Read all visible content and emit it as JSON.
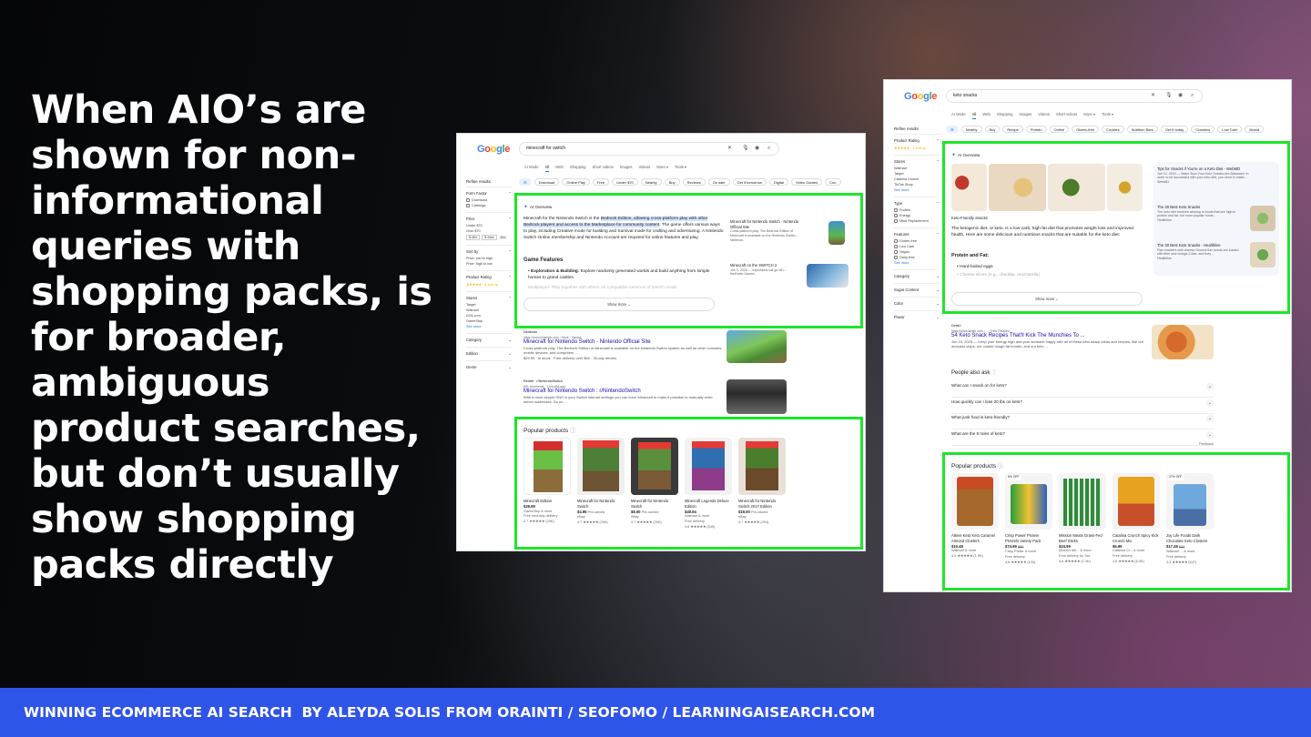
{
  "headline": "When AIO’s are shown for non-informational queries with shopping packs, is for broader, ambiguous product searches, but don’t usually show shopping packs directly",
  "footer": "WINNING ECOMMERCE AI SEARCH  BY ALEYDA SOLIS FROM ORAINTI / SEOFOMO / LEARNINGAISEARCH.COM",
  "colors": {
    "footer_bg": "#2f54e8",
    "highlight_box": "#1ee52b",
    "text": "#ffffff"
  },
  "left_screenshot": {
    "logo": [
      "G",
      "o",
      "o",
      "g",
      "l",
      "e"
    ],
    "query": "minecraft for switch",
    "tabs": [
      "AI Mode",
      "All",
      "Web",
      "Shopping",
      "Short videos",
      "Images",
      "Videos",
      "More ▾",
      "Tools ▾"
    ],
    "chips": [
      "Download",
      "Online Play",
      "Free",
      "Under $70",
      "Nearby",
      "Buy",
      "Reviews",
      "On sale",
      "Get it tomorrow",
      "Digital",
      "Video Games",
      "Con"
    ],
    "sidebar": {
      "title": "Refine results",
      "form_factor": "Form Factor",
      "ff_opts": [
        "Download",
        "Cartridge"
      ],
      "price": "Price",
      "price_opts": [
        "Under $70",
        "Over $70"
      ],
      "price_min": "$ Min",
      "price_max": "$ Max",
      "price_go": "Go",
      "sort": "Sort by",
      "sort_opts": [
        "Price: low to high",
        "Price: high to low"
      ],
      "rating": "Product Rating",
      "rating_val": "★★★★★ · 4 and up",
      "stores": "Stores",
      "stores_opts": [
        "Target",
        "Walmart",
        "G2A.com",
        "GameStop"
      ],
      "see_more": "See more",
      "category": "Category",
      "edition": "Edition",
      "genre": "Genre"
    },
    "aio": {
      "label": "AI Overview",
      "p1_a": "Minecraft for the Nintendo Switch is the ",
      "p1_hl": "Bedrock Edition, allowing cross-platform play with other Bedrock players and access to the Marketplace for community content",
      "p1_b": ". The game offers various ways to play, including Creative mode for building and Survival mode for crafting and adventuring. A Nintendo Switch Online membership and Nintendo Account are required for online features and play.",
      "features_title": "Game Features",
      "feature1_b": "Exploration & Building:",
      "feature1": " Explore randomly generated worlds and build anything from simple homes to grand castles.",
      "feature2": "Multiplayer: Play together with others on compatible versions of Switch mode.",
      "show_more": "Show more ⌄",
      "side1_title": "Minecraft for Nintendo Switch - Nintendo Official Site",
      "side1_desc": "Cross-platform play. The Bedrock Edition of Minecraft is available on the Nintendo Switch...",
      "side1_src": "Nintendo",
      "side2_title": "Minecraft on the SWITCH 2",
      "side2_desc": "Jun 5, 2025 — explosions will go off i...",
      "side2_src": "theRobin Games"
    },
    "results": [
      {
        "src": "Nintendo",
        "url": "https://www.nintendo.com › Store › Games",
        "title": "Minecraft for Nintendo Switch - Nintendo Official Site",
        "desc": "Cross-platform play. The Bedrock Edition of Minecraft is available on the Nintendo Switch system as well as other consoles, mobile devices, and computers ...",
        "extra": "$29.99 · In stock · Free delivery over $50 · 30-day returns"
      },
      {
        "src": "Reddit · r/NintendoSwitch",
        "url": "50+ comments · 3 months ago",
        "title": "Minecraft for Nintendo Switch : r/NintendoSwitch",
        "desc": "With a more simple DNS in your Switch internet settings you can force Minecraft to make it possible to manually enter server addresses. So no ..."
      }
    ],
    "popular_title": "Popular products",
    "products": [
      {
        "name": "Minecraft Edition",
        "price": "$29.99",
        "store": "GameStop & more",
        "ship": "Free next-day delivery",
        "rating": "4.7 ★★★★★ (29K)"
      },
      {
        "name": "Minecraft for Nintendo Switch",
        "price": "$4.95",
        "pre": "Pre-owned",
        "store": "eBay",
        "rating": "4.7 ★★★★★ (29K)"
      },
      {
        "name": "Minecraft for Nintendo Switch",
        "price": "$8.00",
        "pre": "Pre-owned",
        "store": "eBay",
        "rating": "4.7 ★★★★★ (29K)"
      },
      {
        "name": "Minecraft Legends Deluxe Edition",
        "price": "$49.94",
        "store": "Walmart & more",
        "ship": "Free delivery",
        "rating": "4.6 ★★★★★ (549)"
      },
      {
        "name": "Minecraft for Nintendo Switch 2017 Edition",
        "price": "$19.00",
        "pre": "Pre-owned",
        "store": "eBay",
        "rating": "4.7 ★★★★★ (294)"
      }
    ]
  },
  "right_screenshot": {
    "query": "keto snacks",
    "tabs": [
      "AI Mode",
      "All",
      "Web",
      "Shopping",
      "Images",
      "Videos",
      "Short videos",
      "More ▾",
      "Tools ▾"
    ],
    "chips": [
      "Nearby",
      "Buy",
      "Recipe",
      "Protein",
      "Online",
      "Gluten-free",
      "Cookies",
      "Nutrition Bars",
      "Get it today",
      "Crackers",
      "Low Carb",
      "Brand"
    ],
    "sidebar": {
      "title": "Refine results",
      "rating": "Product Rating",
      "rating_val": "★★★★★ · 4 and up",
      "stores": "Stores",
      "stores_opts": [
        "Walmart",
        "Target",
        "Catalina Crunch",
        "TikTok Shop"
      ],
      "see_more": "See more",
      "type": "Type",
      "type_opts": [
        "Protein",
        "Energy",
        "Meal Replacement"
      ],
      "features": "Features",
      "features_opts": [
        "Gluten-free",
        "Low Carb",
        "Vegan",
        "Dairy-free"
      ],
      "see_more2": "See more",
      "category": "Category",
      "sugar": "Sugar Content",
      "color": "Color",
      "flavor": "Flavor"
    },
    "aio": {
      "label": "AI Overview",
      "caption": "Keto-Friendly Snacks",
      "p1": "The ketogenic diet, or keto, is a low-carb, high-fat diet that promotes weight loss and improved health. Here are some delicious and nutritious snacks that are suitable for the keto diet:",
      "sub": "Protein and Fat:",
      "b1": "Hard-boiled eggs",
      "b2": "Cheese slices (e.g., cheddar, mozzarella)",
      "show_more": "Show more ⌄",
      "side1_title": "Tips for Snacks if You're on a Keto Diet - WebMD",
      "side1_desc": "Jun 12, 2024 — Make Sure Your Keto Snacks Are Balanced. In order to be successful with your keto diet, you need to make...",
      "side1_src": "WebMD",
      "side2_title": "The 30 Best Keto Snacks",
      "side2_desc": "The keto diet involves sticking to foods that are high in protein and fat, but most popular foods ...",
      "side2_src": "Healthline",
      "side3_title": "The 30 Best Keto Snacks - Healthline",
      "side3_desc": "Flax crackers with cheese Ground flax seeds are loaded with fiber and omega-3 fats, and they ...",
      "side3_src": "Healthline"
    },
    "result": {
      "src": "Delish",
      "url": "https://www.delish.com › ... › Keto Recipes",
      "title": "54 Keto Snack Recipes That'll Kick The Munchies To ...",
      "desc": "Jun 15, 2025 — Keep your energy high and your stomach happy with all of these keto snack ideas and recipes, like our avocado chips, our cookie dough fat bombs, and our keto ..."
    },
    "paa_title": "People also ask",
    "paa": [
      "What can I snack on for keto?",
      "How quickly can I lose 20 lbs on keto?",
      "What junk food is keto-friendly?",
      "What are the 9 rules of keto?"
    ],
    "feedback": "Feedback",
    "popular_title": "Popular products",
    "products": [
      {
        "name": "Atkins Keto Keto Caramel Almond Clusters",
        "price": "$10.48",
        "store": "Walmart & more",
        "rating": "4.5 ★★★★★ (1.9K)"
      },
      {
        "badge": "6% OFF",
        "name": "Crisp Power Protein Pretzels Variety Pack",
        "price": "$74.99",
        "old": "$80",
        "store": "Crisp Power & more",
        "ship": "Free delivery",
        "rating": "4.6 ★★★★★ (100)"
      },
      {
        "name": "Mission Meats Grass-Fed Beef Sticks",
        "price": "$24.99",
        "store": "Mission Me... & more",
        "ship": "Free delivery by Tue",
        "rating": "4.6 ★★★★★ (1.3K)"
      },
      {
        "name": "Catalina Crunch Spicy Kick Crunch Mix",
        "price": "$6.99",
        "store": "Catalina Cr... & more",
        "ship": "Free delivery",
        "rating": "4.6 ★★★★★ (6.4K)"
      },
      {
        "badge": "27% OFF",
        "name": "Joy Life Foods Dark Chocolate Keto Clusters",
        "price": "$17.48",
        "old": "$24",
        "store": "Walmart ... & more",
        "ship": "Free delivery",
        "rating": "4.3 ★★★★★ (647)"
      }
    ]
  }
}
